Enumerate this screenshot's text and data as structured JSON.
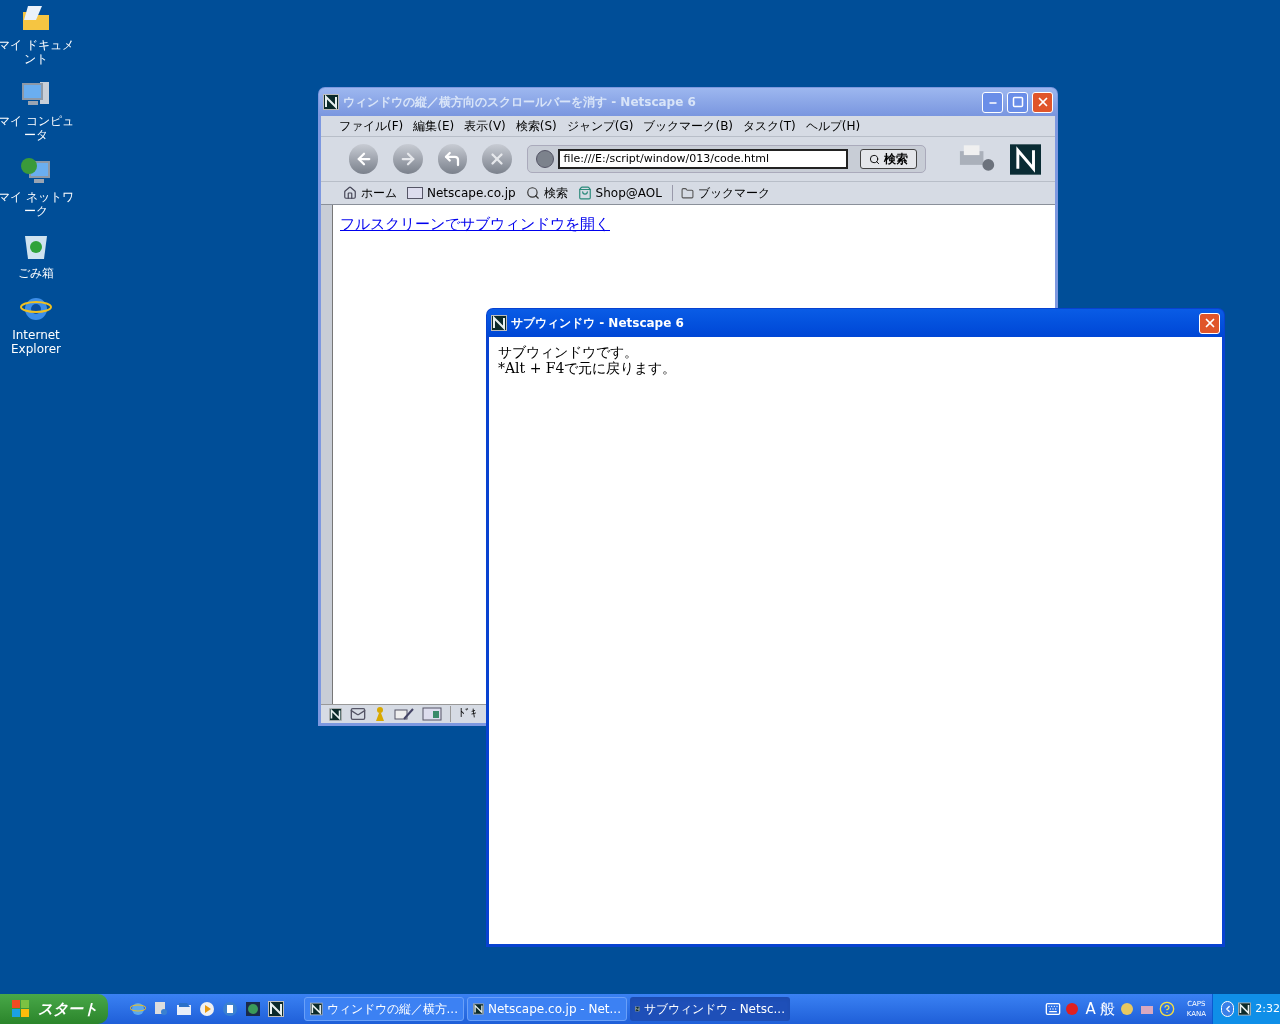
{
  "desktop_icons": [
    {
      "label": "マイ ドキュメント",
      "kind": "documents"
    },
    {
      "label": "マイ コンピュータ",
      "kind": "computer"
    },
    {
      "label": "マイ ネットワーク",
      "kind": "network"
    },
    {
      "label": "ごみ箱",
      "kind": "trash"
    },
    {
      "label": "Internet Explorer",
      "kind": "browser"
    }
  ],
  "main_window": {
    "title": "ウィンドウの縦／横方向のスクロールバーを消す - Netscape 6",
    "active": false,
    "menu": [
      "ファイル(F)",
      "編集(E)",
      "表示(V)",
      "検索(S)",
      "ジャンプ(G)",
      "ブックマーク(B)",
      "タスク(T)",
      "ヘルプ(H)"
    ],
    "url": "file:///E:/script/window/013/code.html",
    "search_button": "検索",
    "personal_toolbar": [
      {
        "label": "ホーム",
        "kind": "home"
      },
      {
        "label": "Netscape.co.jp",
        "kind": "my"
      },
      {
        "label": "検索",
        "kind": "search"
      },
      {
        "label": "Shop@AOL",
        "kind": "shop"
      },
      {
        "label": "ブックマーク",
        "kind": "folder"
      }
    ],
    "link": "フルスクリーンでサブウィンドウを開く",
    "status_text": "ﾄﾞｷ"
  },
  "sub_window": {
    "title": "サブウィンドウ - Netscape 6",
    "active": true,
    "lines": [
      "サブウィンドウです。",
      "*Alt + F4で元に戻ります。"
    ]
  },
  "taskbar": {
    "start": "スタート",
    "tasks": [
      {
        "label": "ウィンドウの縦／横方...",
        "selected": false
      },
      {
        "label": "Netscape.co.jp - Net...",
        "selected": false
      },
      {
        "label": "サブウィンドウ - Netsc...",
        "selected": true
      }
    ],
    "ime": [
      "A",
      "般"
    ],
    "caps": "CAPS",
    "kana": "KANA",
    "clock": "2:32"
  }
}
